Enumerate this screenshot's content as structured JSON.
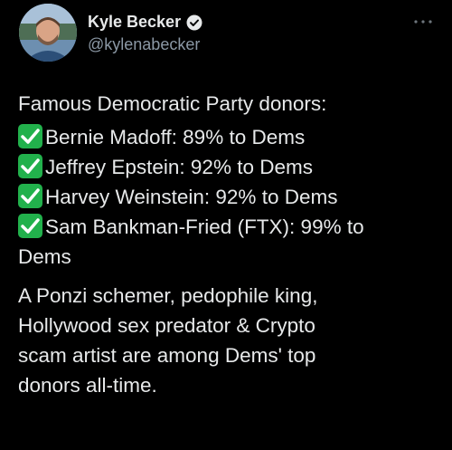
{
  "author": {
    "name": "Kyle Becker",
    "handle": "@kylenabecker",
    "verified_icon": "verified-badge-icon",
    "more_icon": "more-icon"
  },
  "tweet": {
    "heading": "Famous Democratic Party donors:",
    "items": [
      {
        "check_icon": "check-box-icon",
        "text": "Bernie Madoff: 89% to Dems"
      },
      {
        "check_icon": "check-box-icon",
        "text": "Jeffrey Epstein: 92% to Dems"
      },
      {
        "check_icon": "check-box-icon",
        "text": "Harvey Weinstein: 92% to Dems"
      },
      {
        "check_icon": "check-box-icon",
        "text": "Sam Bankman-Fried (FTX): 99% to"
      }
    ],
    "item_wrap": "Dems",
    "paragraph_lines": [
      "A Ponzi schemer, pedophile king,",
      "Hollywood sex predator & Crypto",
      "scam artist are among Dems' top",
      "donors all-time."
    ]
  },
  "colors": {
    "background": "#000000",
    "text": "#e7e9ea",
    "secondary": "#8b98a5",
    "check": "#22b14c"
  }
}
